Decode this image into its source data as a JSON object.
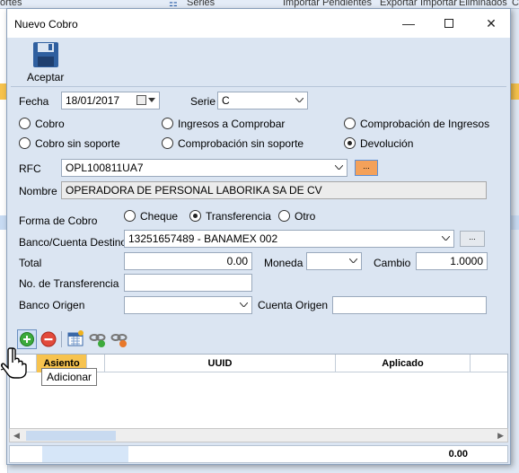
{
  "background": {
    "topbar": [
      "ortes",
      "Series",
      "Importar Pendientes",
      "Exportar",
      "Importar",
      "Eliminados",
      "C"
    ]
  },
  "window": {
    "title": "Nuevo Cobro",
    "minimize": "—",
    "close": "✕"
  },
  "toolbar": {
    "save_label": "Aceptar"
  },
  "form": {
    "fecha_label": "Fecha",
    "fecha_value": "18/01/2017",
    "serie_label": "Serie",
    "serie_value": "C",
    "radios": {
      "cobro": "Cobro",
      "ingresos": "Ingresos a Comprobar",
      "comprobacion_ingresos": "Comprobación de Ingresos",
      "cobro_sin_soporte": "Cobro sin soporte",
      "comprobacion_sin_soporte": "Comprobación sin soporte",
      "devolucion": "Devolución",
      "selected": "devolucion"
    },
    "rfc_label": "RFC",
    "rfc_value": "OPL100811UA7",
    "ellipsis": "...",
    "nombre_label": "Nombre",
    "nombre_value": "OPERADORA DE PERSONAL LABORIKA SA DE CV",
    "forma_label": "Forma de Cobro",
    "forma_options": {
      "cheque": "Cheque",
      "transferencia": "Transferencia",
      "otro": "Otro",
      "selected": "transferencia"
    },
    "banco_destino_label": "Banco/Cuenta Destino",
    "banco_destino_value": "13251657489 - BANAMEX  002",
    "total_label": "Total",
    "total_value": "0.00",
    "moneda_label": "Moneda",
    "moneda_value": "",
    "cambio_label": "Cambio",
    "cambio_value": "1.0000",
    "transferencia_label": "No. de Transferencia",
    "transferencia_value": "",
    "banco_origen_label": "Banco Origen",
    "banco_origen_value": "",
    "cuenta_origen_label": "Cuenta Origen",
    "cuenta_origen_value": ""
  },
  "grid": {
    "columns": [
      "Asiento",
      "UUID",
      "Aplicado"
    ],
    "footer_total": "0.00"
  },
  "tooltip": "Adicionar",
  "colors": {
    "accent_orange": "#f4a15a",
    "header_orange": "#f7c34f",
    "window_bg": "#dbe5f2"
  }
}
